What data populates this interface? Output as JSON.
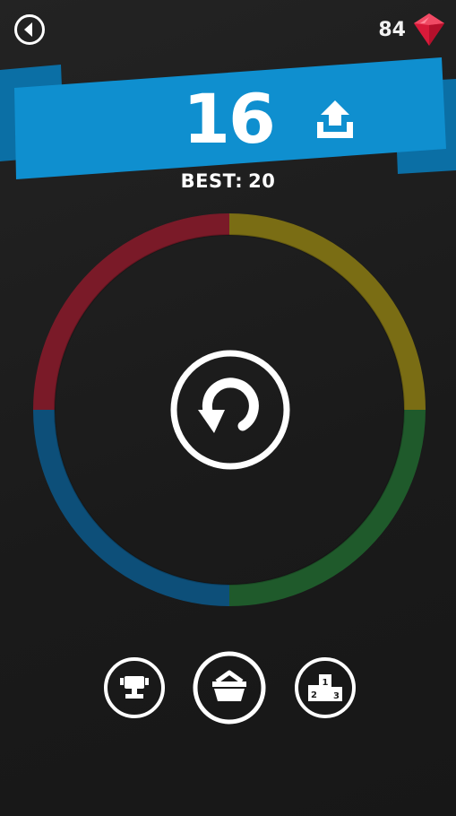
{
  "header": {
    "back_icon": "back-arrow-icon",
    "gem_count": "84",
    "gem_icon": "red-gem-icon"
  },
  "score_banner": {
    "score": "16",
    "share_icon": "share-upload-icon",
    "banner_color": "#0f8fcf"
  },
  "best": {
    "label": "BEST:",
    "value": "20"
  },
  "color_ring": {
    "segments": [
      "#7a1a28",
      "#7a6d14",
      "#1f5a2b",
      "#0d4f79"
    ],
    "center_icon": "replay-icon"
  },
  "bottom_buttons": [
    {
      "icon": "trophy-icon"
    },
    {
      "icon": "shop-basket-icon"
    },
    {
      "icon": "leaderboard-podium-icon"
    }
  ]
}
